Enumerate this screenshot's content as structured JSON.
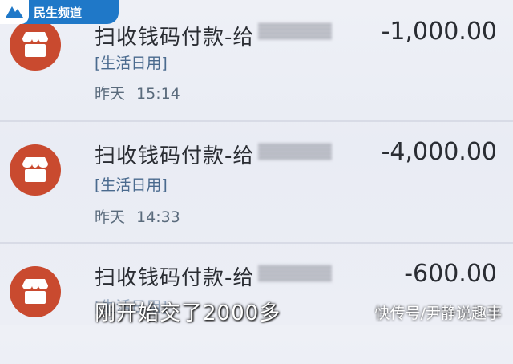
{
  "channel_logo": {
    "text": "民生频道"
  },
  "transactions": [
    {
      "title": "扫收钱码付款-给",
      "category": "[生活日用]",
      "day": "昨天",
      "clock": "15:14",
      "amount": "-1,000.00"
    },
    {
      "title": "扫收钱码付款-给",
      "category": "[生活日用]",
      "day": "昨天",
      "clock": "14:33",
      "amount": "-4,000.00"
    },
    {
      "title": "扫收钱码付款-给",
      "category": "[生活日用]",
      "day": "",
      "clock": "",
      "amount": "-600.00"
    }
  ],
  "subtitle": "刚开始交了2000多",
  "watermark": "快传号/尹静说趣事",
  "icons": {
    "avatar": "shop-icon"
  },
  "colors": {
    "avatar_bg": "#c94a2f",
    "logo_bg": "#1f78c8"
  }
}
